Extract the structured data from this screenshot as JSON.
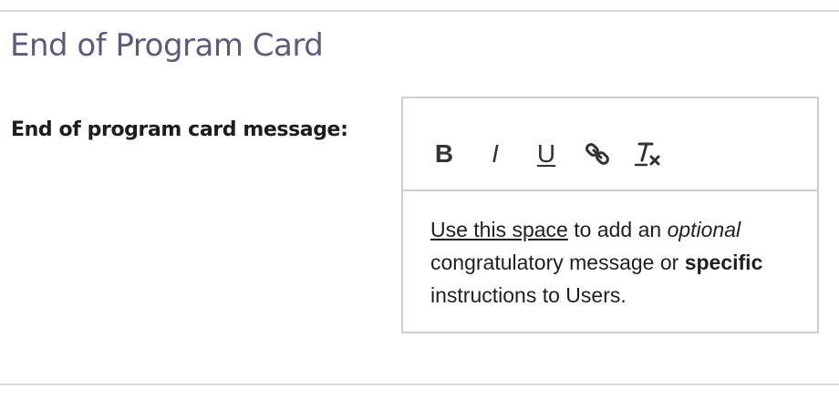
{
  "section": {
    "title": "End of Program Card"
  },
  "field": {
    "label": "End of program card message:"
  },
  "toolbar": {
    "buttons": [
      {
        "name": "bold",
        "glyph": "B",
        "icon": "bold-icon"
      },
      {
        "name": "italic",
        "glyph": "I",
        "icon": "italic-icon"
      },
      {
        "name": "underline",
        "glyph": "U",
        "icon": "underline-icon"
      },
      {
        "name": "link",
        "icon": "link-icon"
      },
      {
        "name": "clear-format",
        "glyph": "T",
        "icon": "clear-formatting-icon"
      }
    ]
  },
  "editor": {
    "segments": {
      "s1": "Use this space",
      "s2": " to add an ",
      "s3": "optional",
      "s4": " congratulatory message or ",
      "s5": "specific",
      "s6": " instructions to Users."
    }
  },
  "colors": {
    "title": "#5a5d78",
    "label": "#1d1d1d",
    "border": "#cfcfcf",
    "divider": "#d8d8d8",
    "icon": "#333333"
  }
}
